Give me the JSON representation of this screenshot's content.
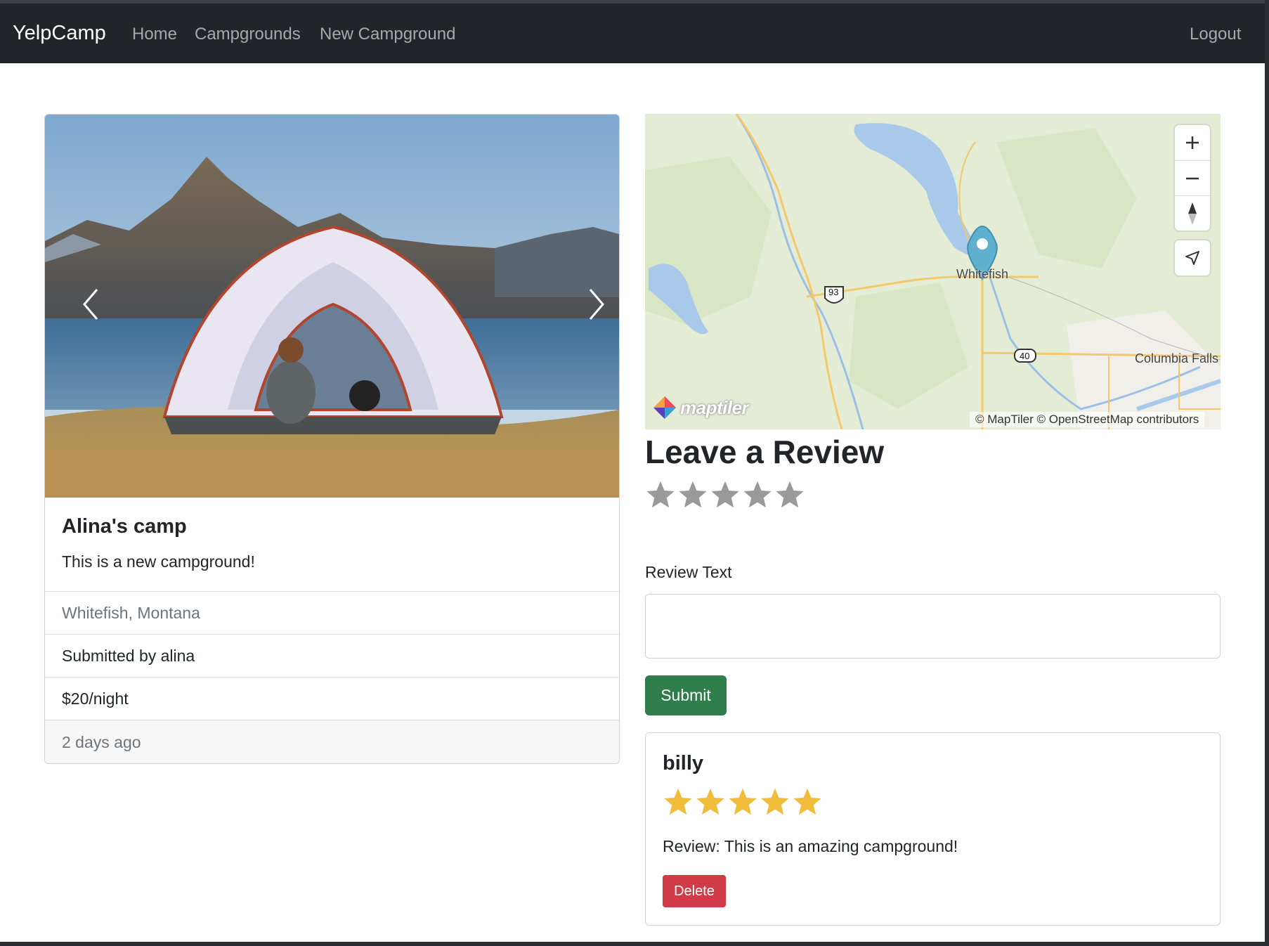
{
  "navbar": {
    "brand": "YelpCamp",
    "links": [
      "Home",
      "Campgrounds",
      "New Campground"
    ],
    "logout": "Logout"
  },
  "campground": {
    "title": "Alina's camp",
    "description": "This is a new campground!",
    "location": "Whitefish, Montana",
    "submitted_by": "Submitted by alina",
    "price": "$20/night",
    "posted": "2 days ago"
  },
  "map": {
    "labels": {
      "city": "Whitefish",
      "town": "Columbia Falls",
      "route_93": "93",
      "route_40": "40"
    },
    "logo_text": "maptiler",
    "attribution": "© MapTiler © OpenStreetMap contributors",
    "marker_color": "#5fb0cf"
  },
  "review_form": {
    "title": "Leave a Review",
    "rating_value": 0,
    "rating_max": 5,
    "text_label": "Review Text",
    "text_value": "",
    "submit_label": "Submit"
  },
  "reviews": [
    {
      "author": "billy",
      "rating": 5,
      "rating_max": 5,
      "text": "Review: This is an amazing campground!",
      "delete_label": "Delete"
    }
  ],
  "colors": {
    "navbar_bg": "#212529",
    "submit_bg": "#2f7d4a",
    "delete_bg": "#d03b47",
    "star_filled": "#f0bc39",
    "star_empty": "#999999"
  },
  "icons": [
    "chevron-left-icon",
    "chevron-right-icon",
    "zoom-in-icon",
    "zoom-out-icon",
    "compass-icon",
    "geolocate-icon",
    "map-marker-icon",
    "star-icon"
  ]
}
